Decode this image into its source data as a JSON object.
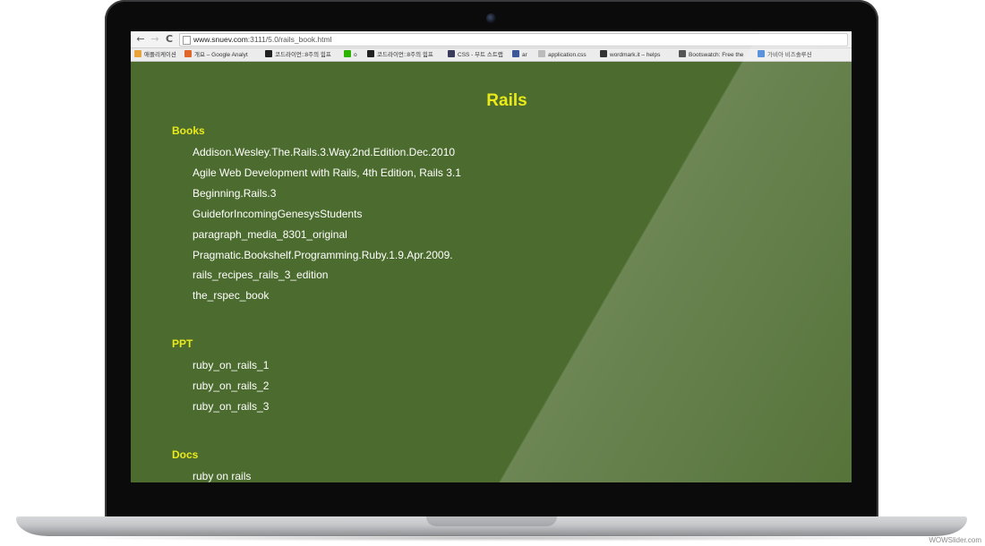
{
  "browser": {
    "url_host": "www.snuev.com",
    "url_path": ":3111/5.0/rails_book.html",
    "back_glyph": "←",
    "forward_glyph": "→",
    "reload_glyph": "C",
    "bookmarks": [
      {
        "label": "애플리케이션",
        "icon": "apps-grid-icon",
        "color": "#e8a33b"
      },
      {
        "label": "개요 – Google Analyt",
        "icon": "analytics-icon",
        "color": "#e0662a"
      },
      {
        "label": "코드라이언::8주의 힘프",
        "icon": "coderlion-icon",
        "color": "#222222"
      },
      {
        "label": "o",
        "icon": "naver-icon",
        "color": "#2db400"
      },
      {
        "label": "코드라이언::8주의 힘프",
        "icon": "coderlion-icon",
        "color": "#222222"
      },
      {
        "label": "CSS - 부트 스트랩",
        "icon": "bootstrap-icon",
        "color": "#3b3b5c"
      },
      {
        "label": "ar",
        "icon": "facebook-icon",
        "color": "#3b5998"
      },
      {
        "label": "application.css",
        "icon": "file-icon",
        "color": "#bbbbbb"
      },
      {
        "label": "wordmark.it – helps",
        "icon": "wordmark-icon",
        "color": "#333333"
      },
      {
        "label": "Bootswatch: Free the",
        "icon": "bootswatch-icon",
        "color": "#555555"
      },
      {
        "label": "가비아 비즈솔루션",
        "icon": "gabia-icon",
        "color": "#3a7bd5"
      }
    ]
  },
  "page": {
    "title": "Rails",
    "sections": [
      {
        "heading": "Books",
        "items": [
          "Addison.Wesley.The.Rails.3.Way.2nd.Edition.Dec.2010",
          "Agile Web Development with Rails, 4th Edition, Rails 3.1",
          "Beginning.Rails.3",
          "GuideforIncomingGenesysStudents",
          "paragraph_media_8301_original",
          "Pragmatic.Bookshelf.Programming.Ruby.1.9.Apr.2009.",
          "rails_recipes_rails_3_edition",
          "the_rspec_book"
        ]
      },
      {
        "heading": "PPT",
        "items": [
          "ruby_on_rails_1",
          "ruby_on_rails_2",
          "ruby_on_rails_3"
        ]
      },
      {
        "heading": "Docs",
        "items": [
          "ruby on rails"
        ]
      }
    ]
  },
  "watermark": "WOWSlider.com",
  "colors": {
    "background": "#4c6b2e",
    "heading": "#eaea1a",
    "link": "#ffffff"
  }
}
